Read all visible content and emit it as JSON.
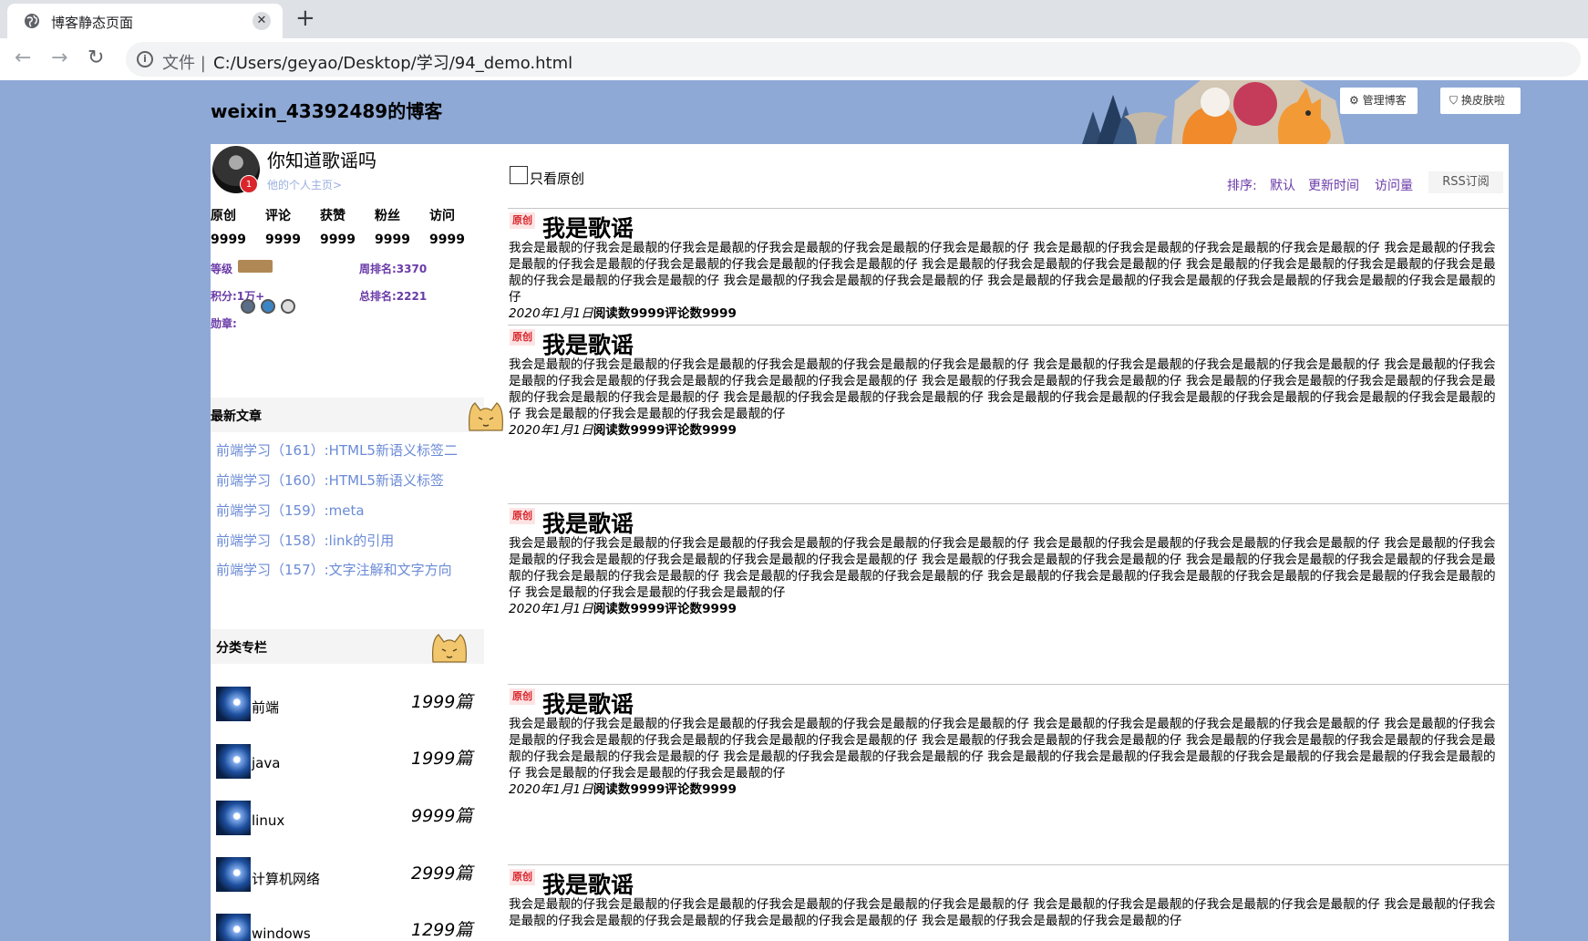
{
  "browser": {
    "tab_title": "博客静态页面",
    "url_scheme": "文件 |",
    "url": "C:/Users/geyao/Desktop/学习/94_demo.html",
    "icons": [
      "globe-icon",
      "close-icon",
      "plus-icon",
      "back-arrow-icon",
      "forward-arrow-icon",
      "reload-icon",
      "info-icon"
    ]
  },
  "header": {
    "blog_title": "weixin_43392489的博客",
    "manage_button": "⚙ 管理博客",
    "skin_button": "⛉ 换皮肤啦"
  },
  "profile": {
    "name": "你知道歌谣吗",
    "home_link": "他的个人主页>",
    "badge_text": "1",
    "stats": [
      {
        "label": "原创",
        "value": "9999"
      },
      {
        "label": "评论",
        "value": "9999"
      },
      {
        "label": "获赞",
        "value": "9999"
      },
      {
        "label": "粉丝",
        "value": "9999"
      },
      {
        "label": "访问",
        "value": "9999"
      }
    ],
    "level_label": "等级",
    "week_rank": "周排名:3370",
    "points": "积分:1万+",
    "total_rank": "总排名:2221",
    "medals_label": "勋章:"
  },
  "recent": {
    "title": "最新文章",
    "items": [
      "前端学习（161）:HTML5新语义标签二",
      "前端学习（160）:HTML5新语义标签",
      "前端学习（159）:meta",
      "前端学习（158）:link的引用",
      "前端学习（157）:文字注解和文字方向"
    ]
  },
  "columns": {
    "title": "分类专栏",
    "items": [
      {
        "name": "前端",
        "count": "1999篇"
      },
      {
        "name": "java",
        "count": "1999篇"
      },
      {
        "name": "linux",
        "count": "9999篇"
      },
      {
        "name": "计算机网络",
        "count": "2999篇"
      },
      {
        "name": "windows",
        "count": "1299篇"
      }
    ]
  },
  "toolbar": {
    "only_original": "只看原创",
    "sort_label": "排序:",
    "sort_default": "默认",
    "sort_updated": "更新时间",
    "sort_views": "访问量",
    "rss": "RSS订阅"
  },
  "articles": [
    {
      "badge": "原创",
      "title": "我是歌谣",
      "body": "我会是最靓的仔我会是最靓的仔我会是最靓的仔我会是最靓的仔我会是最靓的仔我会是最靓的仔 我会是最靓的仔我会是最靓的仔我会是最靓的仔我会是最靓的仔 我会是最靓的仔我会是最靓的仔我会是最靓的仔我会是最靓的仔我会是最靓的仔我会是最靓的仔 我会是最靓的仔我会是最靓的仔我会是最靓的仔 我会是最靓的仔我会是最靓的仔我会是最靓的仔我会是最靓的仔我会是最靓的仔我会是最靓的仔 我会是最靓的仔我会是最靓的仔我会是最靓的仔 我会是最靓的仔我会是最靓的仔我会是最靓的仔我会是最靓的仔我会是最靓的仔我会是最靓的仔",
      "date": "2020年1月1日",
      "stats": "阅读数9999评论数9999"
    },
    {
      "badge": "原创",
      "title": "我是歌谣",
      "body": "我会是最靓的仔我会是最靓的仔我会是最靓的仔我会是最靓的仔我会是最靓的仔我会是最靓的仔 我会是最靓的仔我会是最靓的仔我会是最靓的仔我会是最靓的仔 我会是最靓的仔我会是最靓的仔我会是最靓的仔我会是最靓的仔我会是最靓的仔我会是最靓的仔 我会是最靓的仔我会是最靓的仔我会是最靓的仔 我会是最靓的仔我会是最靓的仔我会是最靓的仔我会是最靓的仔我会是最靓的仔我会是最靓的仔 我会是最靓的仔我会是最靓的仔我会是最靓的仔 我会是最靓的仔我会是最靓的仔我会是最靓的仔我会是最靓的仔我会是最靓的仔我会是最靓的仔 我会是最靓的仔我会是最靓的仔我会是最靓的仔",
      "date": "2020年1月1日",
      "stats": "阅读数9999评论数9999"
    },
    {
      "badge": "原创",
      "title": "我是歌谣",
      "body": "我会是最靓的仔我会是最靓的仔我会是最靓的仔我会是最靓的仔我会是最靓的仔我会是最靓的仔 我会是最靓的仔我会是最靓的仔我会是最靓的仔我会是最靓的仔 我会是最靓的仔我会是最靓的仔我会是最靓的仔我会是最靓的仔我会是最靓的仔我会是最靓的仔 我会是最靓的仔我会是最靓的仔我会是最靓的仔 我会是最靓的仔我会是最靓的仔我会是最靓的仔我会是最靓的仔我会是最靓的仔我会是最靓的仔 我会是最靓的仔我会是最靓的仔我会是最靓的仔 我会是最靓的仔我会是最靓的仔我会是最靓的仔我会是最靓的仔我会是最靓的仔我会是最靓的仔 我会是最靓的仔我会是最靓的仔我会是最靓的仔",
      "date": "2020年1月1日",
      "stats": "阅读数9999评论数9999"
    },
    {
      "badge": "原创",
      "title": "我是歌谣",
      "body": "我会是最靓的仔我会是最靓的仔我会是最靓的仔我会是最靓的仔我会是最靓的仔我会是最靓的仔 我会是最靓的仔我会是最靓的仔我会是最靓的仔我会是最靓的仔 我会是最靓的仔我会是最靓的仔我会是最靓的仔我会是最靓的仔我会是最靓的仔我会是最靓的仔 我会是最靓的仔我会是最靓的仔我会是最靓的仔 我会是最靓的仔我会是最靓的仔我会是最靓的仔我会是最靓的仔我会是最靓的仔我会是最靓的仔 我会是最靓的仔我会是最靓的仔我会是最靓的仔 我会是最靓的仔我会是最靓的仔我会是最靓的仔我会是最靓的仔我会是最靓的仔我会是最靓的仔 我会是最靓的仔我会是最靓的仔我会是最靓的仔",
      "date": "2020年1月1日",
      "stats": "阅读数9999评论数9999"
    },
    {
      "badge": "原创",
      "title": "我是歌谣",
      "body": "我会是最靓的仔我会是最靓的仔我会是最靓的仔我会是最靓的仔我会是最靓的仔我会是最靓的仔 我会是最靓的仔我会是最靓的仔我会是最靓的仔我会是最靓的仔 我会是最靓的仔我会是最靓的仔我会是最靓的仔我会是最靓的仔我会是最靓的仔我会是最靓的仔 我会是最靓的仔我会是最靓的仔我会是最靓的仔",
      "date": "",
      "stats": ""
    }
  ],
  "colors": {
    "page_bg": "#8fa9d6",
    "link_blue": "#6b8bd6",
    "meta_purple": "#6a3aa8",
    "original_red": "#d9252b"
  }
}
